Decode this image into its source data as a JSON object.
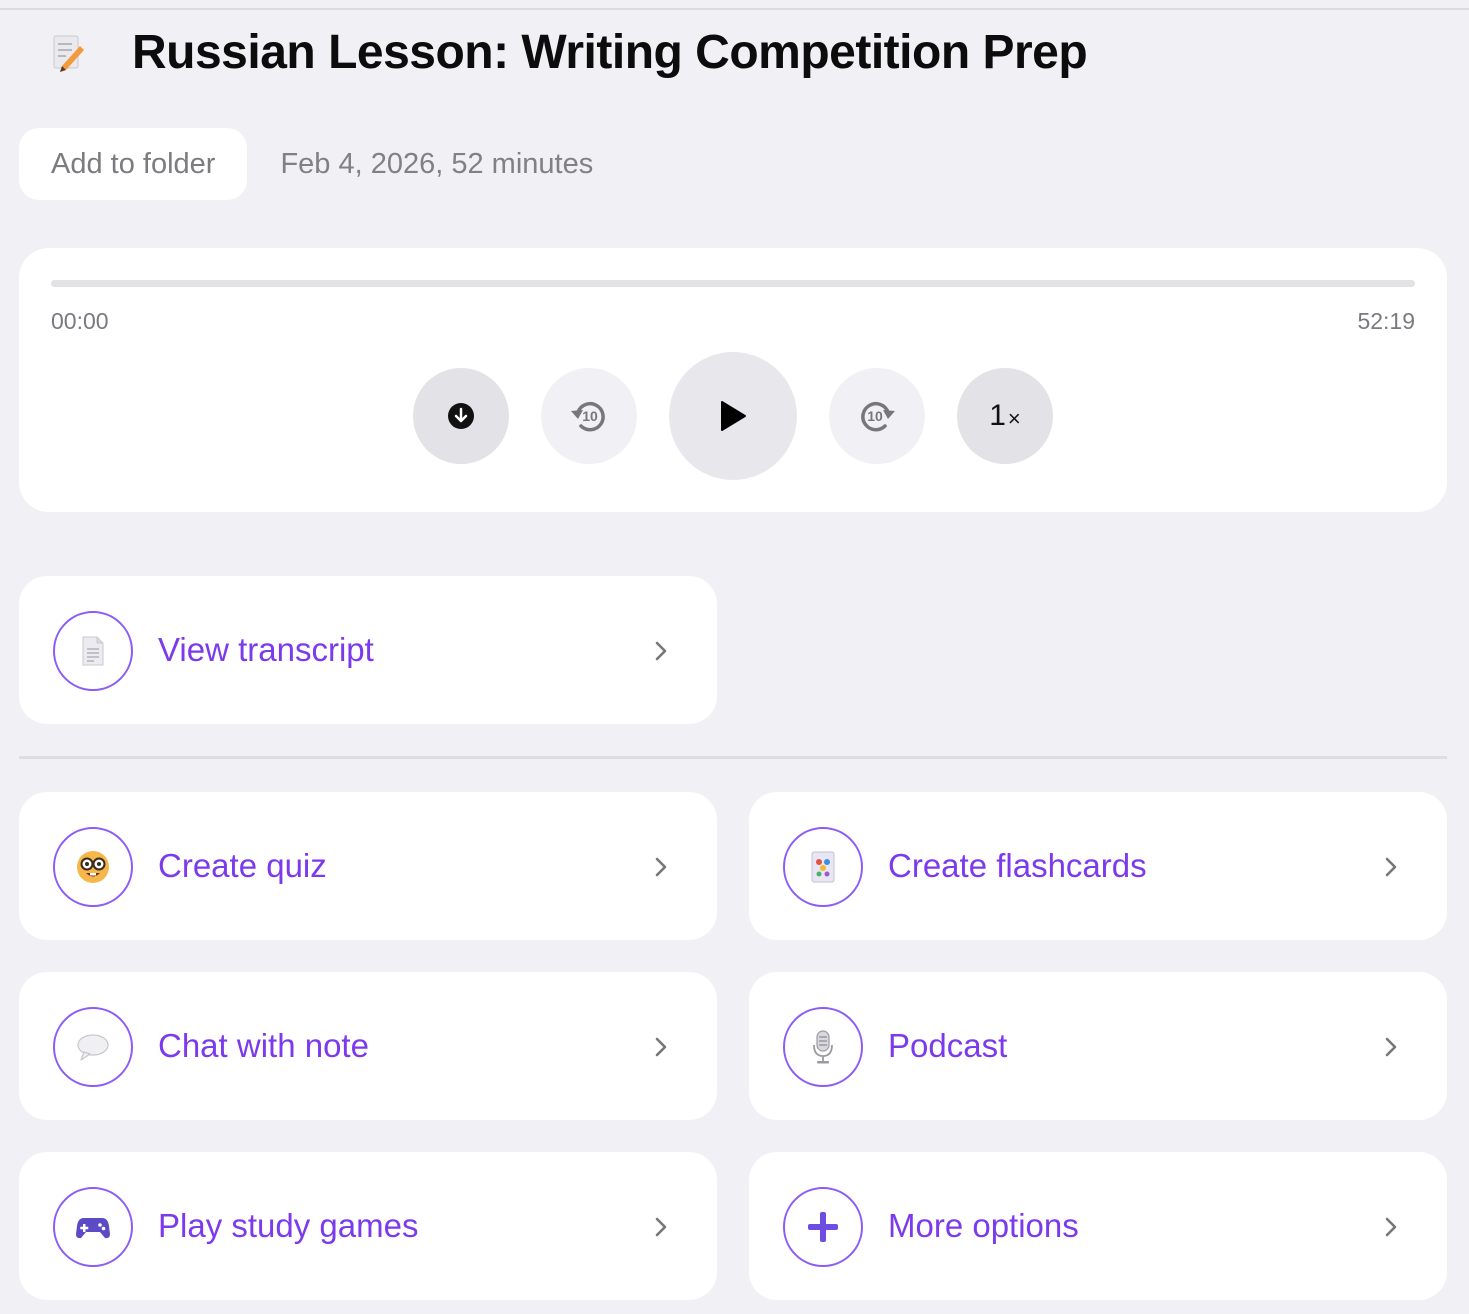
{
  "header": {
    "title": "Russian Lesson: Writing Competition Prep",
    "icon": "memo-icon"
  },
  "meta": {
    "add_to_folder_label": "Add to folder",
    "date_duration": "Feb 4, 2026, 52 minutes"
  },
  "player": {
    "current_time": "00:00",
    "total_time": "52:19",
    "progress": 0,
    "speed_value": "1",
    "speed_suffix": "×",
    "skip_back_seconds": "10",
    "skip_forward_seconds": "10",
    "accent_color": "#7c3aed"
  },
  "actions": {
    "transcript": {
      "label": "View transcript",
      "icon": "page-icon"
    },
    "quiz": {
      "label": "Create quiz",
      "icon": "nerd-face-icon"
    },
    "flashcards": {
      "label": "Create flashcards",
      "icon": "flashcard-icon"
    },
    "chat": {
      "label": "Chat with note",
      "icon": "speech-bubble-icon"
    },
    "podcast": {
      "label": "Podcast",
      "icon": "microphone-icon"
    },
    "games": {
      "label": "Play study games",
      "icon": "game-controller-icon"
    },
    "more": {
      "label": "More options",
      "icon": "plus-icon"
    }
  },
  "colors": {
    "background": "#f1f0f5",
    "card": "#ffffff",
    "label_purple": "#7c3aed",
    "muted_text": "#7b7b80"
  }
}
